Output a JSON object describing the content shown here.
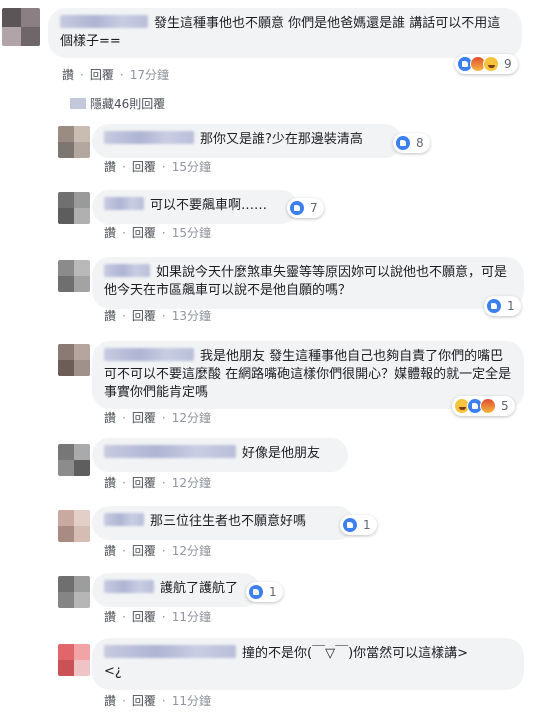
{
  "comments": [
    {
      "text": "發生這種事他也不願意 你們是他爸媽還是誰 講話可以不用這個樣子==",
      "like": "讚",
      "reply": "回覆",
      "time": "17分鐘",
      "reactions": "9",
      "avatar_colors": [
        "#5c5558",
        "#8b7f84",
        "#b0a4a8",
        "#6e6669"
      ]
    },
    {
      "text": "那你又是誰?少在那邊裝清高",
      "like": "讚",
      "reply": "回覆",
      "time": "15分鐘",
      "reactions": "8",
      "avatar_colors": [
        "#9a8c82",
        "#c9bcb1",
        "#7d7670",
        "#b3a79f"
      ]
    },
    {
      "text": "可以不要飆車啊……",
      "like": "讚",
      "reply": "回覆",
      "time": "15分鐘",
      "reactions": "7",
      "avatar_colors": [
        "#707070",
        "#9a9a9a",
        "#5d5d5d",
        "#b0b0b0"
      ]
    },
    {
      "text": "如果說今天什麼煞車失靈等等原因妳可以說他也不願意，可是他今天在市區飆車可以說不是他自願的嗎？",
      "like": "讚",
      "reply": "回覆",
      "time": "13分鐘",
      "reactions": "1",
      "avatar_colors": [
        "#8b8b8b",
        "#b9b9b9",
        "#6f6f6f",
        "#a3a3a3"
      ]
    },
    {
      "text": "我是他朋友 發生這種事他自己也夠自責了你們的嘴巴可不可以不要這麼酸 在網路嘴砲這樣你們很開心？媒體報的就一定全是事實你們能肯定嗎",
      "like": "讚",
      "reply": "回覆",
      "time": "12分鐘",
      "reactions": "5",
      "avatar_colors": [
        "#8a7a74",
        "#b5a59e",
        "#6b5d58",
        "#a0918b"
      ]
    },
    {
      "text": "好像是他朋友",
      "like": "讚",
      "reply": "回覆",
      "time": "12分鐘",
      "reactions": "",
      "avatar_colors": [
        "#777",
        "#aaa",
        "#8c8c8c",
        "#5e5e5e"
      ]
    },
    {
      "text": "那三位往生者也不願意好嗎",
      "like": "讚",
      "reply": "回覆",
      "time": "12分鐘",
      "reactions": "1",
      "avatar_colors": [
        "#c8aaa0",
        "#e3cfc7",
        "#a88b82",
        "#d6bdb4"
      ]
    },
    {
      "text": "護航了護航了",
      "like": "讚",
      "reply": "回覆",
      "time": "11分鐘",
      "reactions": "1",
      "avatar_colors": [
        "#6f6f6f",
        "#9d9d9d",
        "#858585",
        "#b6b6b6"
      ]
    },
    {
      "text": "撞的不是你(￣▽￣)你當然可以這樣講>\n<¿",
      "like": "讚",
      "reply": "回覆",
      "time": "11分鐘",
      "reactions": "",
      "avatar_colors": [
        "#e0666b",
        "#f2a3a6",
        "#c95257",
        "#f0c4c6"
      ]
    }
  ],
  "hidden_replies": "隱藏46則回覆",
  "colors": {
    "bubble": "#f2f3f5",
    "link": "#4b4f56",
    "meta": "#90949c",
    "like_blue": "#3b7ff0"
  }
}
